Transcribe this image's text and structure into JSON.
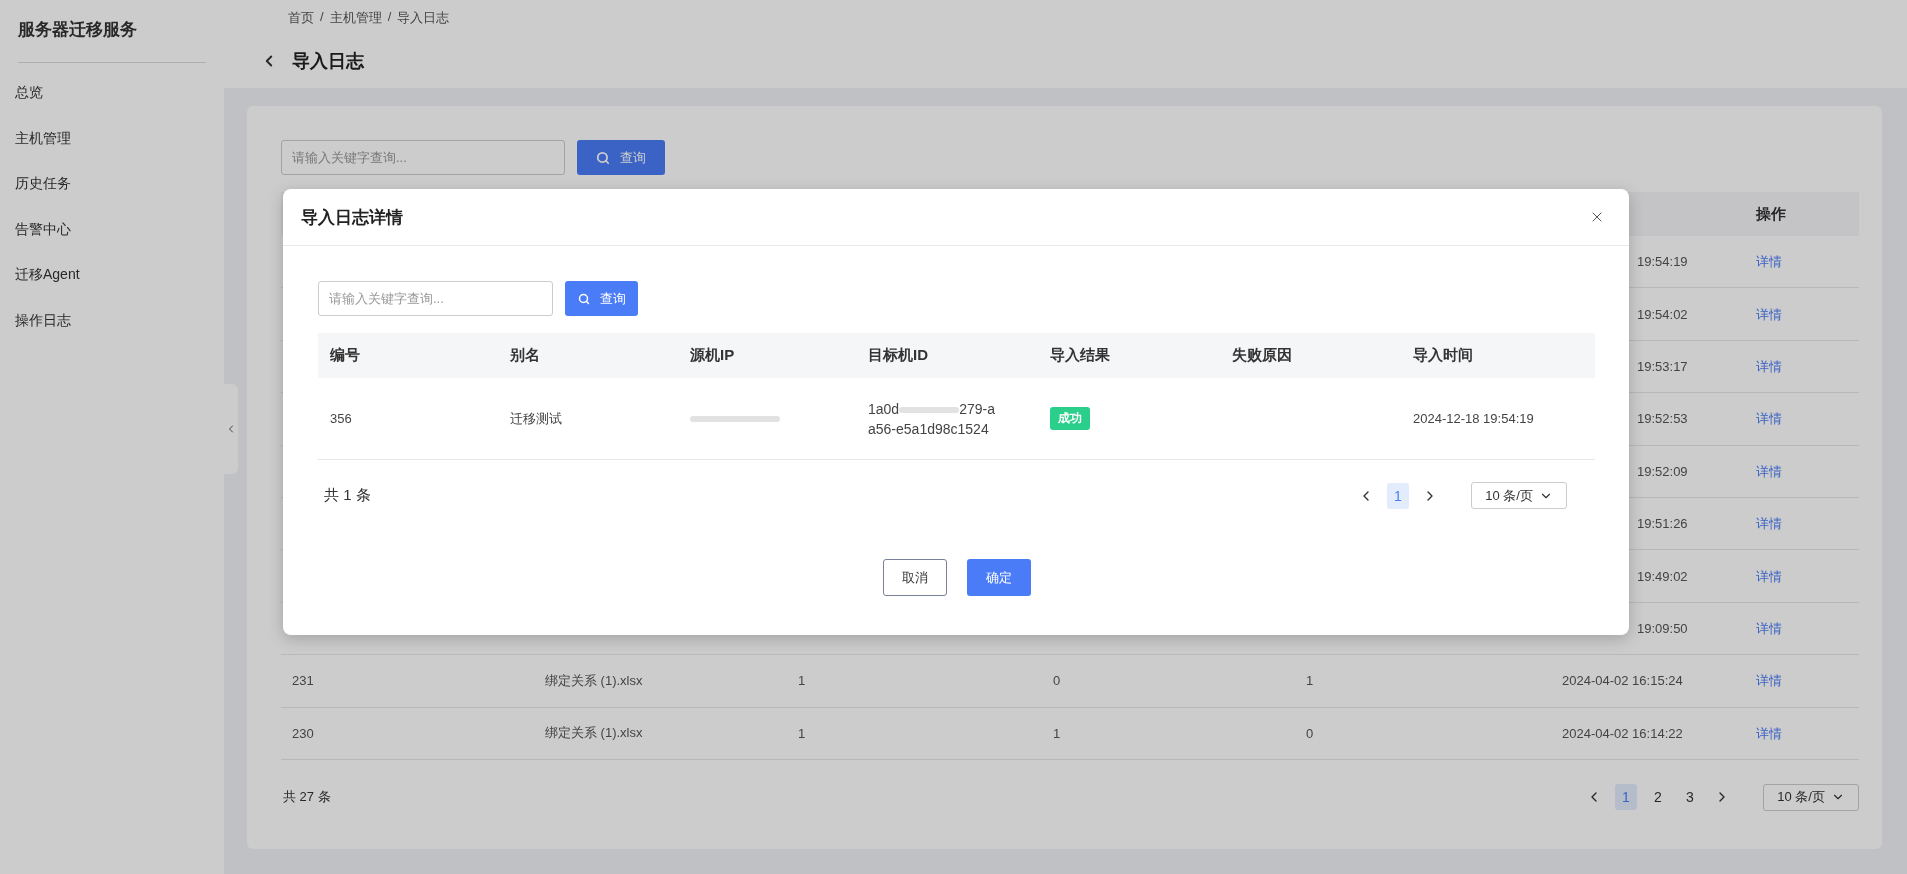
{
  "sidebar": {
    "title": "服务器迁移服务",
    "items": [
      {
        "label": "总览"
      },
      {
        "label": "主机管理"
      },
      {
        "label": "历史任务"
      },
      {
        "label": "告警中心"
      },
      {
        "label": "迁移Agent"
      },
      {
        "label": "操作日志"
      }
    ]
  },
  "breadcrumb": {
    "items": [
      "首页",
      "主机管理",
      "导入日志"
    ],
    "separator": "/"
  },
  "page_title": "导入日志",
  "search": {
    "placeholder": "请输入关键字查询...",
    "button": "查询"
  },
  "table": {
    "action_column": "操作",
    "rows": [
      {
        "kind": "covered",
        "time": "19:54:19",
        "action": "详情"
      },
      {
        "kind": "covered",
        "time": "19:54:02",
        "action": "详情"
      },
      {
        "kind": "covered",
        "time": "19:53:17",
        "action": "详情"
      },
      {
        "kind": "covered",
        "time": "19:52:53",
        "action": "详情"
      },
      {
        "kind": "covered",
        "time": "19:52:09",
        "action": "详情"
      },
      {
        "kind": "covered",
        "time": "19:51:26",
        "action": "详情"
      },
      {
        "kind": "covered",
        "time": "19:49:02",
        "action": "详情"
      },
      {
        "kind": "covered",
        "time": "19:09:50",
        "action": "详情"
      },
      {
        "kind": "full",
        "cells": [
          "231",
          "绑定关系 (1).xlsx",
          "1",
          "0",
          "1",
          "2024-04-02 16:15:24"
        ],
        "action": "详情"
      },
      {
        "kind": "full",
        "cells": [
          "230",
          "绑定关系 (1).xlsx",
          "1",
          "1",
          "0",
          "2024-04-02 16:14:22"
        ],
        "action": "详情"
      }
    ]
  },
  "footer": {
    "total": "共 27 条",
    "pages": [
      {
        "label": "1",
        "selected": true
      },
      {
        "label": "2",
        "selected": false
      },
      {
        "label": "3",
        "selected": false
      }
    ],
    "page_size": "10 条/页"
  },
  "modal": {
    "title": "导入日志详情",
    "search": {
      "placeholder": "请输入关键字查询...",
      "button": "查询"
    },
    "columns": [
      "编号",
      "别名",
      "源机IP",
      "目标机ID",
      "导入结果",
      "失败原因",
      "导入时间"
    ],
    "rows": [
      {
        "id": "356",
        "alias": "迁移测试",
        "target_id_start": "1a0d",
        "target_id_end": "279-a",
        "target_id_line2": "a56-e5a1d98c1524",
        "result": {
          "label": "成功",
          "kind": "success"
        },
        "time": "2024-12-18 19:54:19"
      }
    ],
    "total": "共 1 条",
    "pages": [
      {
        "label": "1",
        "selected": true
      }
    ],
    "page_size": "10 条/页",
    "buttons": [
      {
        "label": "取消",
        "kind": "secondary"
      },
      {
        "label": "确定",
        "kind": "primary"
      }
    ]
  }
}
